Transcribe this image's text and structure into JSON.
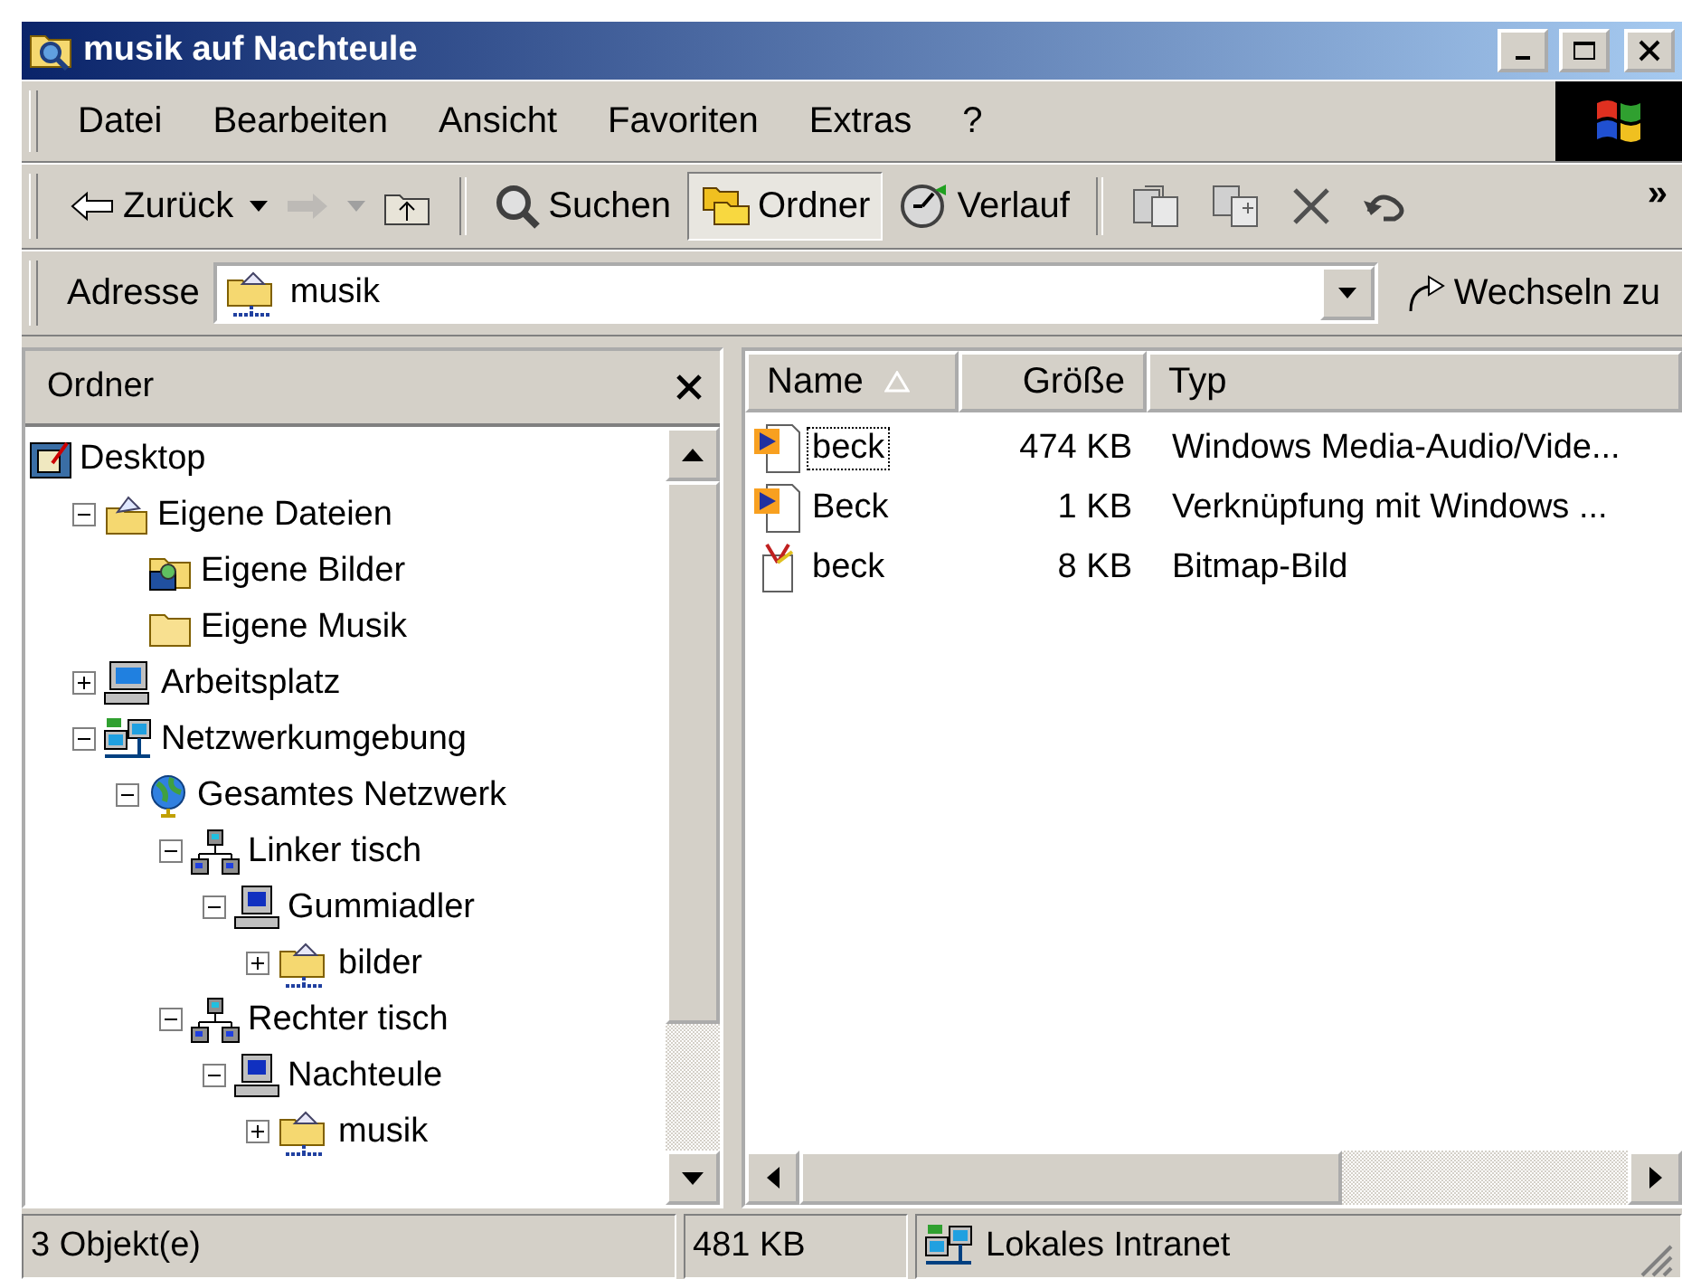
{
  "window": {
    "title": "musik auf Nachteule"
  },
  "menu": [
    "Datei",
    "Bearbeiten",
    "Ansicht",
    "Favoriten",
    "Extras",
    "?"
  ],
  "toolbar": [
    {
      "kind": "back",
      "label": "Zurück",
      "dropdown": true,
      "disabled": false,
      "selected": false
    },
    {
      "kind": "forward",
      "dropdown": true,
      "disabled": true,
      "selected": false
    },
    {
      "kind": "up",
      "dropdown": false,
      "disabled": false,
      "selected": false
    },
    {
      "kind": "separator"
    },
    {
      "kind": "search",
      "label": "Suchen",
      "dropdown": false,
      "disabled": false,
      "selected": false
    },
    {
      "kind": "folders",
      "label": "Ordner",
      "dropdown": false,
      "disabled": false,
      "selected": true
    },
    {
      "kind": "history",
      "label": "Verlauf",
      "dropdown": false,
      "disabled": false,
      "selected": false
    },
    {
      "kind": "separator"
    },
    {
      "kind": "move",
      "dropdown": false,
      "disabled": false,
      "selected": false
    },
    {
      "kind": "copy",
      "dropdown": false,
      "disabled": false,
      "selected": false
    },
    {
      "kind": "delete",
      "dropdown": false,
      "disabled": false,
      "selected": false
    },
    {
      "kind": "undo",
      "dropdown": false,
      "disabled": false,
      "selected": false
    }
  ],
  "toolbar_more": "»",
  "address": {
    "label": "Adresse",
    "value": "musik",
    "go_button": "Wechseln zu"
  },
  "folder_pane": {
    "title": "Ordner",
    "tree": [
      {
        "label": "Desktop",
        "kind": "desktop",
        "children": [
          {
            "label": "Eigene Dateien",
            "kind": "documents",
            "expanded": true,
            "children": [
              {
                "label": "Eigene Bilder",
                "kind": "pictures"
              },
              {
                "label": "Eigene Musik",
                "kind": "folder"
              }
            ]
          },
          {
            "label": "Arbeitsplatz",
            "kind": "computer",
            "expanded": false
          },
          {
            "label": "Netzwerkumgebung",
            "kind": "network",
            "expanded": true,
            "children": [
              {
                "label": "Gesamtes Netzwerk",
                "kind": "globe",
                "expanded": true,
                "children": [
                  {
                    "label": "Linker tisch",
                    "kind": "workgroup",
                    "expanded": true,
                    "children": [
                      {
                        "label": "Gummiadler",
                        "kind": "host",
                        "expanded": true,
                        "children": [
                          {
                            "label": "bilder",
                            "kind": "share",
                            "expanded": false
                          }
                        ]
                      }
                    ]
                  },
                  {
                    "label": "Rechter tisch",
                    "kind": "workgroup",
                    "expanded": true,
                    "children": [
                      {
                        "label": "Nachteule",
                        "kind": "host",
                        "expanded": true,
                        "children": [
                          {
                            "label": "musik",
                            "kind": "share",
                            "expanded": false
                          }
                        ]
                      }
                    ]
                  }
                ]
              }
            ]
          }
        ]
      }
    ]
  },
  "file_list": {
    "columns": [
      {
        "label": "Name",
        "sorted": true
      },
      {
        "label": "Größe",
        "sorted": false
      },
      {
        "label": "Typ",
        "sorted": false
      }
    ],
    "rows": [
      {
        "name": "beck",
        "size": "474 KB",
        "type": "Windows Media-Audio/Vide...",
        "kind": "media",
        "focused": true
      },
      {
        "name": "Beck",
        "size": "1 KB",
        "type": "Verknüpfung mit Windows ...",
        "kind": "media",
        "focused": false
      },
      {
        "name": "beck",
        "size": "8 KB",
        "type": "Bitmap-Bild",
        "kind": "bitmap",
        "focused": false
      }
    ]
  },
  "status_bar": {
    "objects": "3 Objekt(e)",
    "size": "481 KB",
    "zone": "Lokales Intranet"
  }
}
